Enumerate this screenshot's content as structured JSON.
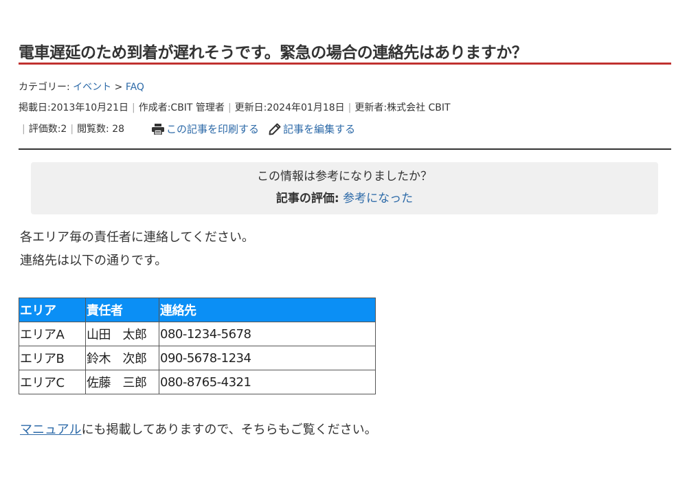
{
  "article": {
    "title": "電車遅延のため到着が遅れそうです。緊急の場合の連絡先はありますか？"
  },
  "meta": {
    "category_label": "カテゴリー: ",
    "category_event": "イベント",
    "category_arrow": " > ",
    "category_faq": "FAQ",
    "published": "掲載日:2013年10月21日",
    "author": "作成者:CBIT 管理者",
    "updated": "更新日:2024年01月18日",
    "updater": "更新者:株式会社 CBIT",
    "rating_count": "評価数:2",
    "view_count": "閲覧数: 28",
    "print_label": "この記事を印刷する",
    "edit_label": "記事を編集する"
  },
  "rating_box": {
    "question": "この情報は参考になりましたか？",
    "rating_label": "記事の評価:",
    "rating_link": "参考になった"
  },
  "content": {
    "para1": "各エリア毎の責任者に連絡してください。",
    "para2": "連絡先は以下の通りです。",
    "manual_link": "マニュアル",
    "para3_rest": "にも掲載してありますので、そちらもご覧ください。"
  },
  "table": {
    "headers": [
      "エリア",
      "責任者",
      "連絡先"
    ],
    "rows": [
      [
        "エリアA",
        "山田　太郎",
        "080-1234-5678"
      ],
      [
        "エリアB",
        "鈴木　次郎",
        "090-5678-1234"
      ],
      [
        "エリアC",
        "佐藤　三郎",
        "080-8765-4321"
      ]
    ]
  },
  "icons": {
    "print": "printer-icon",
    "edit": "pencil-icon"
  },
  "colors": {
    "accent_rule": "#c0312f",
    "link": "#2d6aa8",
    "table_header": "#0b8ff5"
  }
}
